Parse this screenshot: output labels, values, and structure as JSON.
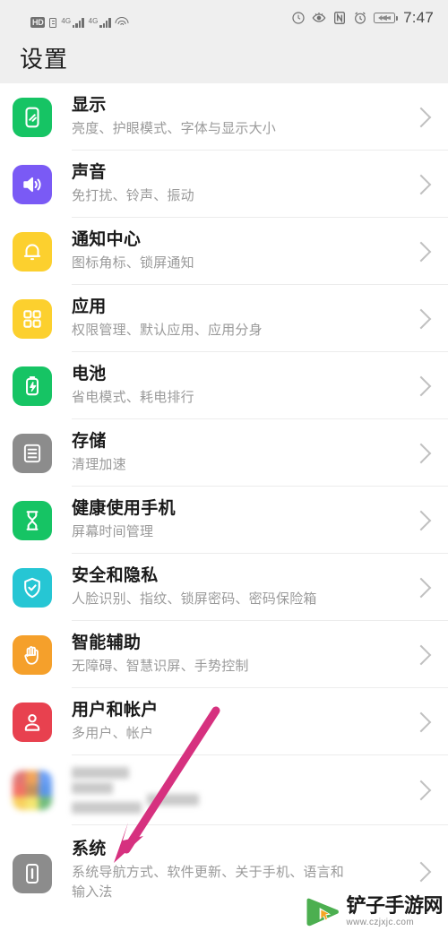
{
  "statusbar": {
    "hd_label": "HD",
    "network_label_1": "4G",
    "network_label_2": "4G",
    "time": "7:47",
    "icons": [
      "hd-volte-icon",
      "sim-card-icon",
      "signal-4g-icon",
      "signal-4g-icon-2",
      "wifi-icon",
      "data-saver-icon",
      "eye-comfort-icon",
      "nfc-icon",
      "alarm-icon",
      "battery-icon"
    ]
  },
  "header": {
    "title": "设置"
  },
  "settings": {
    "items": [
      {
        "id": "display",
        "title": "显示",
        "subtitle": "亮度、护眼模式、字体与显示大小",
        "icon": "display-icon",
        "color": "#16c464"
      },
      {
        "id": "sound",
        "title": "声音",
        "subtitle": "免打扰、铃声、振动",
        "icon": "sound-icon",
        "color": "#7a5af5"
      },
      {
        "id": "notification-center",
        "title": "通知中心",
        "subtitle": "图标角标、锁屏通知",
        "icon": "bell-icon",
        "color": "#fcd02e"
      },
      {
        "id": "apps",
        "title": "应用",
        "subtitle": "权限管理、默认应用、应用分身",
        "icon": "apps-grid-icon",
        "color": "#fcd02e"
      },
      {
        "id": "battery",
        "title": "电池",
        "subtitle": "省电模式、耗电排行",
        "icon": "battery-icon",
        "color": "#16c464"
      },
      {
        "id": "storage",
        "title": "存储",
        "subtitle": "清理加速",
        "icon": "storage-icon",
        "color": "#8c8c8c"
      },
      {
        "id": "digital-balance",
        "title": "健康使用手机",
        "subtitle": "屏幕时间管理",
        "icon": "hourglass-icon",
        "color": "#16c464"
      },
      {
        "id": "security-privacy",
        "title": "安全和隐私",
        "subtitle": "人脸识别、指纹、锁屏密码、密码保险箱",
        "icon": "shield-check-icon",
        "color": "#26c6d4"
      },
      {
        "id": "smart-assistance",
        "title": "智能辅助",
        "subtitle": "无障碍、智慧识屏、手势控制",
        "icon": "hand-icon",
        "color": "#f5a02b"
      },
      {
        "id": "users-accounts",
        "title": "用户和帐户",
        "subtitle": "多用户、帐户",
        "icon": "person-icon",
        "color": "#e8414f"
      }
    ],
    "redacted_item": {
      "id": "redacted",
      "title": "",
      "subtitle": "",
      "icon": "redacted-color-grid-icon"
    },
    "system_item": {
      "id": "system",
      "title": "系统",
      "subtitle": "系统导航方式、软件更新、关于手机、语言和",
      "subtitle_line2": "输入法",
      "icon": "system-phone-icon",
      "color": "#8c8c8c"
    }
  },
  "annotation": {
    "arrow_color": "#d6317f",
    "arrow_name": "pointer-arrow-to-system"
  },
  "watermark": {
    "site_name": "铲子手游网",
    "url": "www.czjxjc.com"
  }
}
